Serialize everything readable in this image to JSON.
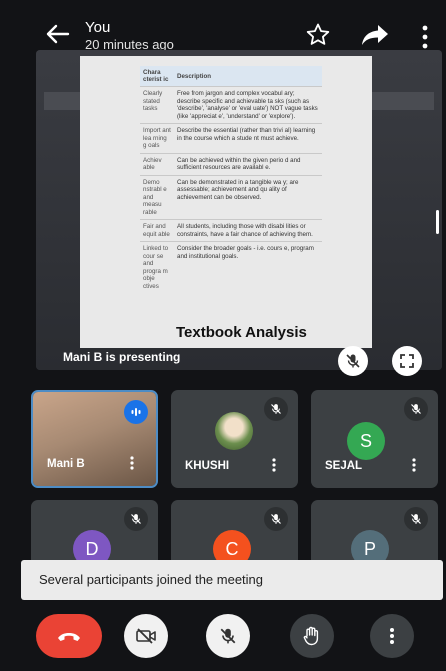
{
  "header": {
    "sender": "You",
    "time": "20 minutes ago"
  },
  "presentation": {
    "presenter_label": "Mani B is presenting",
    "caption": "Textbook Analysis",
    "table": {
      "headers": [
        "Chara cterist ic",
        "Description"
      ],
      "rows": [
        [
          "Clearly stated tasks",
          "Free from jargon and complex vocabul ary; describe specific and achievable ta sks (such as 'describe', 'analyse' or 'eval uate') NOT vague tasks (like 'appreciat e', 'understand' or 'explore')."
        ],
        [
          "Import ant lea rning g oals",
          "Describe the essential (rather than trivi al) learning in the course which a stude nt must achieve."
        ],
        [
          "Achiev able",
          "Can be achieved within the given perio d and sufficient resources are availabl e."
        ],
        [
          "Demo nstrabl e and measu rable",
          "Can be demonstrated in a tangible wa y; are assessable; achievement and qu ality of achievement can be observed."
        ],
        [
          "Fair and equit able",
          "All students, including those with disabi lities or constraints, have a fair chance of achieving them."
        ],
        [
          "Linked to cour se and progra m obje ctives",
          "Consider the broader goals - i.e. cours e, program and institutional goals."
        ]
      ]
    }
  },
  "participants": [
    {
      "name": "Mani B",
      "type": "video",
      "speaking": true
    },
    {
      "name": "KHUSHI",
      "type": "photo",
      "muted": true
    },
    {
      "name": "SEJAL",
      "type": "letter",
      "letter": "S",
      "color": "#34a853",
      "muted": true
    },
    {
      "name": "",
      "type": "letter",
      "letter": "D",
      "color": "#7e57c2",
      "muted": true
    },
    {
      "name": "",
      "type": "letter",
      "letter": "C",
      "color": "#f4511e",
      "muted": true
    },
    {
      "name": "",
      "type": "letter",
      "letter": "P",
      "color": "#546e7a",
      "muted": true
    }
  ],
  "toast": {
    "message": "Several participants joined the meeting"
  },
  "colors": {
    "end_call": "#ea4335",
    "speaking": "#1a73e8",
    "tile_bg": "#3c4043"
  }
}
